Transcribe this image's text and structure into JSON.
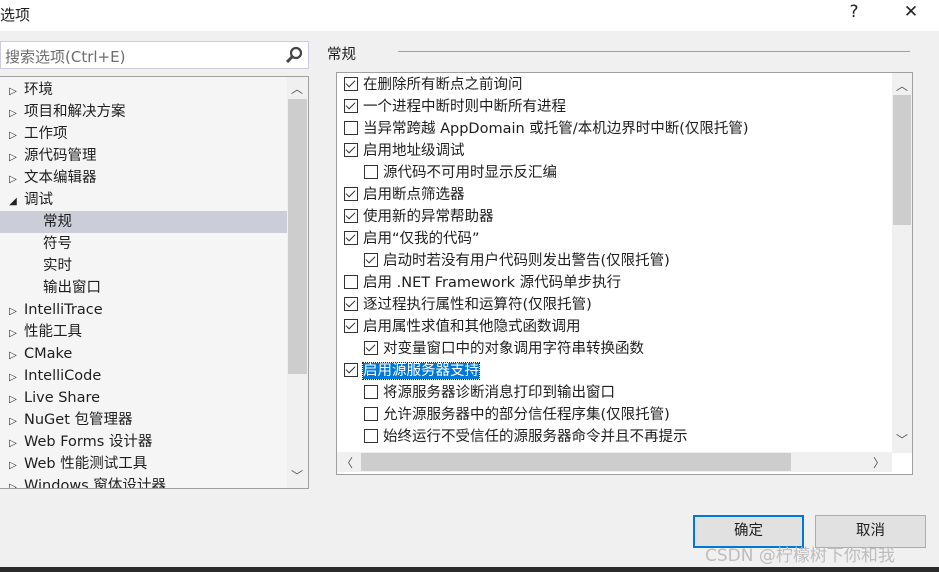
{
  "window": {
    "title": "选项",
    "help": "?",
    "close": "✕"
  },
  "search": {
    "placeholder": "搜索选项(Ctrl+E)"
  },
  "tree": [
    {
      "label": "环境",
      "level": 0,
      "state": "collapsed"
    },
    {
      "label": "项目和解决方案",
      "level": 0,
      "state": "collapsed"
    },
    {
      "label": "工作项",
      "level": 0,
      "state": "collapsed"
    },
    {
      "label": "源代码管理",
      "level": 0,
      "state": "collapsed"
    },
    {
      "label": "文本编辑器",
      "level": 0,
      "state": "collapsed"
    },
    {
      "label": "调试",
      "level": 0,
      "state": "expanded"
    },
    {
      "label": "常规",
      "level": 1,
      "selected": true
    },
    {
      "label": "符号",
      "level": 1
    },
    {
      "label": "实时",
      "level": 1
    },
    {
      "label": "输出窗口",
      "level": 1
    },
    {
      "label": "IntelliTrace",
      "level": 0,
      "state": "collapsed"
    },
    {
      "label": "性能工具",
      "level": 0,
      "state": "collapsed"
    },
    {
      "label": "CMake",
      "level": 0,
      "state": "collapsed"
    },
    {
      "label": "IntelliCode",
      "level": 0,
      "state": "collapsed"
    },
    {
      "label": "Live Share",
      "level": 0,
      "state": "collapsed"
    },
    {
      "label": "NuGet 包管理器",
      "level": 0,
      "state": "collapsed"
    },
    {
      "label": "Web Forms 设计器",
      "level": 0,
      "state": "collapsed"
    },
    {
      "label": "Web 性能测试工具",
      "level": 0,
      "state": "collapsed"
    },
    {
      "label": "Windows 窗体设计器",
      "level": 0,
      "state": "collapsed"
    }
  ],
  "section_title": "常规",
  "options": [
    {
      "label": "在删除所有断点之前询问",
      "checked": true,
      "level": 0
    },
    {
      "label": "一个进程中断时则中断所有进程",
      "checked": true,
      "level": 0
    },
    {
      "label": "当异常跨越 AppDomain 或托管/本机边界时中断(仅限托管)",
      "checked": false,
      "level": 0
    },
    {
      "label": "启用地址级调试",
      "checked": true,
      "level": 0
    },
    {
      "label": "源代码不可用时显示反汇编",
      "checked": false,
      "level": 1
    },
    {
      "label": "启用断点筛选器",
      "checked": true,
      "level": 0
    },
    {
      "label": "使用新的异常帮助器",
      "checked": true,
      "level": 0
    },
    {
      "label": "启用“仅我的代码”",
      "checked": true,
      "level": 0
    },
    {
      "label": "启动时若没有用户代码则发出警告(仅限托管)",
      "checked": true,
      "level": 1
    },
    {
      "label": "启用 .NET Framework 源代码单步执行",
      "checked": false,
      "level": 0
    },
    {
      "label": "逐过程执行属性和运算符(仅限托管)",
      "checked": true,
      "level": 0
    },
    {
      "label": "启用属性求值和其他隐式函数调用",
      "checked": true,
      "level": 0
    },
    {
      "label": "对变量窗口中的对象调用字符串转换函数",
      "checked": true,
      "level": 1
    },
    {
      "label": "启用源服务器支持",
      "checked": true,
      "level": 0,
      "highlighted": true
    },
    {
      "label": "将源服务器诊断消息打印到输出窗口",
      "checked": false,
      "level": 1
    },
    {
      "label": "允许源服务器中的部分信任程序集(仅限托管)",
      "checked": false,
      "level": 1
    },
    {
      "label": "始终运行不受信任的源服务器命令并且不再提示",
      "checked": false,
      "level": 1
    }
  ],
  "buttons": {
    "ok": "确定",
    "cancel": "取消"
  },
  "watermark": "CSDN @柠檬树下你和我",
  "colors": {
    "accent": "#0078d7",
    "selection": "#cbcdd9"
  }
}
